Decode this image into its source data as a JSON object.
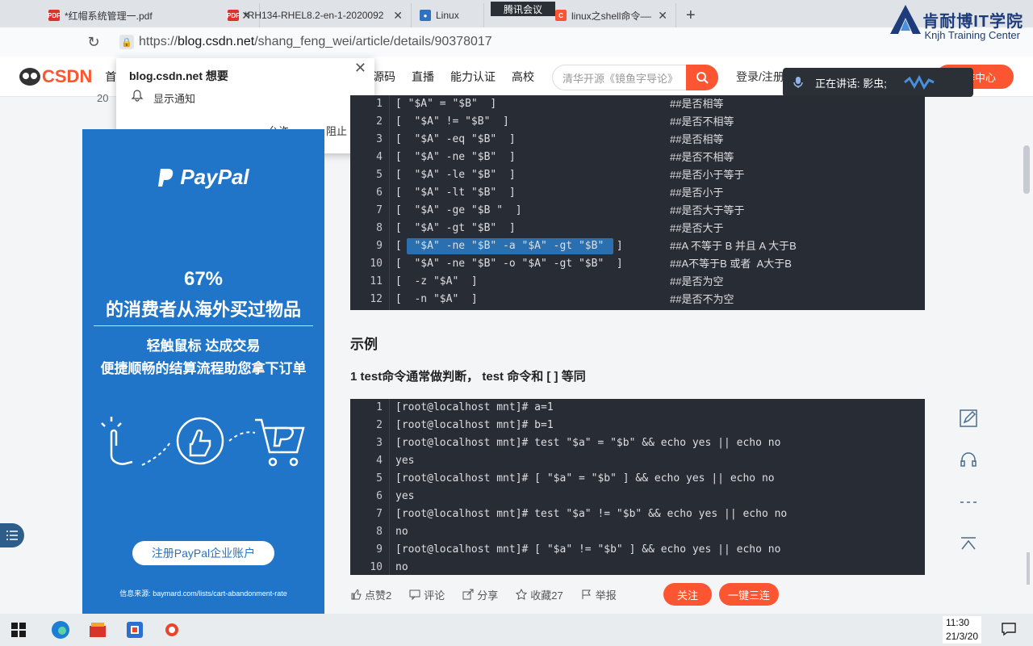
{
  "tabs": [
    {
      "label": "*红帽系统管理一.pdf",
      "favicon": "pdf",
      "color": "#d9342b"
    },
    {
      "label": "*RH134-RHEL8.2-en-1-2020092",
      "favicon": "pdf",
      "color": "#d9342b"
    },
    {
      "label": "Linux",
      "favicon": "paw",
      "color": "#3071c2"
    },
    {
      "label": "linux之shell命令——条件判断",
      "favicon": "C",
      "color": "#fc5531",
      "active": true
    }
  ],
  "meeting_tab": "腾讯会议",
  "address": {
    "scheme": "https://",
    "host": "blog.csdn.net",
    "path": "/shang_feng_wei/article/details/90378017"
  },
  "brand": {
    "name": "肯耐博IT学院",
    "sub": "Knjh Training Center"
  },
  "header": {
    "logo": "CSDN",
    "home": "首页",
    "nav": [
      "源码",
      "直播",
      "能力认证",
      "高校"
    ],
    "search_placeholder": "清华开源《镜鱼字导论》",
    "login": "登录/注册",
    "creator": "创作中心",
    "date_fragment": "20"
  },
  "meeting": {
    "label": "正在讲话: 影虫;"
  },
  "notification": {
    "title": "blog.csdn.net 想要",
    "text": "显示通知",
    "allow": "允许",
    "block": "阻止"
  },
  "ad": {
    "brand": "PayPal",
    "percent": "67%",
    "headline": "的消费者从海外买过物品",
    "sub1": "轻触鼠标 达成交易",
    "sub2": "便捷顺畅的结算流程助您拿下订单",
    "button": "注册PayPal企业账户",
    "source": "信息来源: baymard.com/lists/cart-abandonment-rate",
    "bg": "#2175c9"
  },
  "code1": [
    {
      "n": "1",
      "code": "[ \"$A\" = \"$B\"  ]",
      "comment": "##是否相等"
    },
    {
      "n": "2",
      "code": "[  \"$A\" != \"$B\"  ]",
      "comment": "##是否不相等"
    },
    {
      "n": "3",
      "code": "[  \"$A\" -eq \"$B\"  ]",
      "comment": "##是否相等"
    },
    {
      "n": "4",
      "code": "[  \"$A\" -ne \"$B\"  ]",
      "comment": "##是否不相等"
    },
    {
      "n": "5",
      "code": "[  \"$A\" -le \"$B\"  ]",
      "comment": "##是否小于等于"
    },
    {
      "n": "6",
      "code": "[  \"$A\" -lt \"$B\"  ]",
      "comment": "##是否小于"
    },
    {
      "n": "7",
      "code": "[  \"$A\" -ge \"$B \"  ]",
      "comment": "##是否大于等于"
    },
    {
      "n": "8",
      "code": "[  \"$A\" -gt \"$B\"  ]",
      "comment": "##是否大于"
    },
    {
      "n": "9",
      "code": "[  \"$A\" -ne \"$B\" -a \"$A\" -gt \"$B\"  ]",
      "comment": "##A 不等于 B 并且 A 大于B",
      "highlight": true
    },
    {
      "n": "10",
      "code": "[  \"$A\" -ne \"$B\" -o \"$A\" -gt \"$B\"  ]",
      "comment": "##A不等于B 或者  A大于B"
    },
    {
      "n": "11",
      "code": "[  -z \"$A\"  ]",
      "comment": "##是否为空"
    },
    {
      "n": "12",
      "code": "[  -n \"$A\"  ]",
      "comment": "##是否不为空"
    }
  ],
  "heading_example": "示例",
  "heading_test": "1 test命令通常做判断， test 命令和 [ ] 等同",
  "code2": [
    {
      "n": "1",
      "code": "[root@localhost mnt]# a=1"
    },
    {
      "n": "2",
      "code": "[root@localhost mnt]# b=1"
    },
    {
      "n": "3",
      "code": "[root@localhost mnt]# test \"$a\" = \"$b\" && echo yes || echo no"
    },
    {
      "n": "4",
      "code": "yes"
    },
    {
      "n": "5",
      "code": "[root@localhost mnt]# [ \"$a\" = \"$b\" ] && echo yes || echo no"
    },
    {
      "n": "6",
      "code": "yes"
    },
    {
      "n": "7",
      "code": "[root@localhost mnt]# test \"$a\" != \"$b\" && echo yes || echo no"
    },
    {
      "n": "8",
      "code": "no"
    },
    {
      "n": "9",
      "code": "[root@localhost mnt]# [ \"$a\" != \"$b\" ] && echo yes || echo no"
    },
    {
      "n": "10",
      "code": "no"
    }
  ],
  "toolbar": {
    "like": "点赞2",
    "comment": "评论",
    "share": "分享",
    "collect": "收藏27",
    "report": "举报",
    "follow": "关注",
    "triple": "一键三连"
  },
  "taskbar": {
    "time": "11:30",
    "date": "21/3/20"
  }
}
